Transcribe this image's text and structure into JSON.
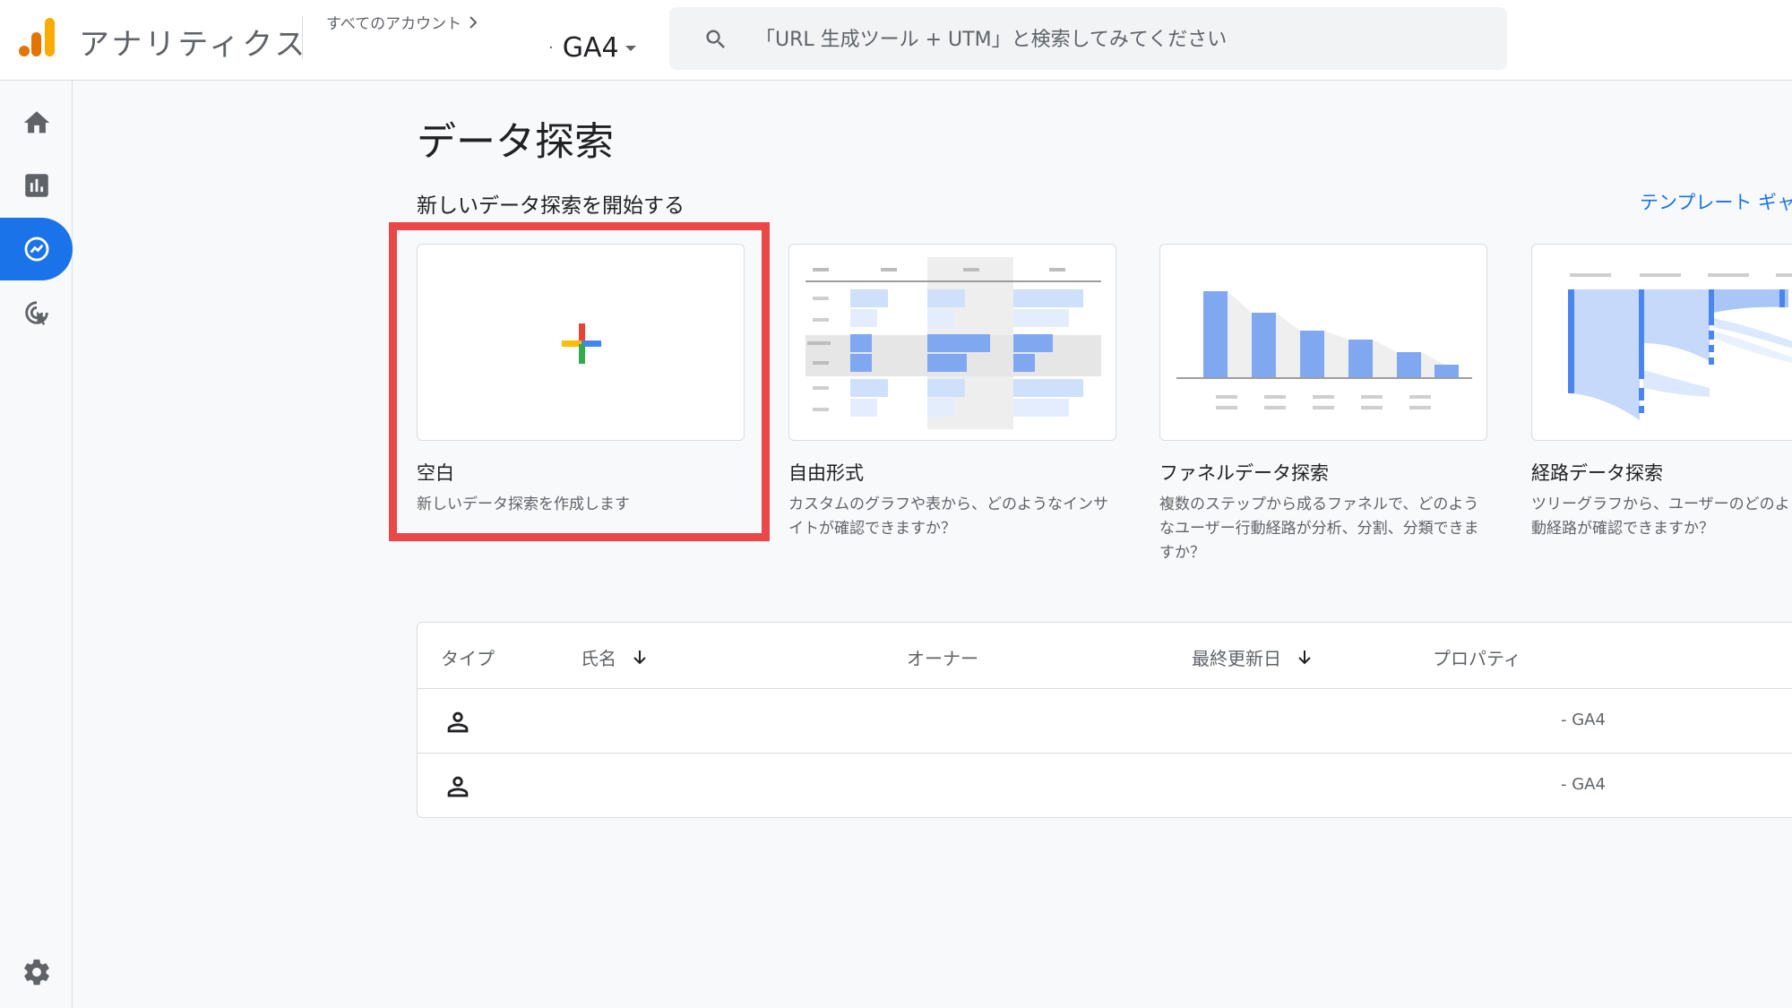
{
  "header": {
    "app_title": "アナリティクス",
    "all_accounts": "すべてのアカウント",
    "property": "GA4",
    "property_prefix": "·",
    "search_placeholder": "「URL 生成ツール + UTM」と検索してみてください"
  },
  "sidebar": {
    "items": [
      {
        "name": "home-icon",
        "active": false
      },
      {
        "name": "reports-icon",
        "active": false
      },
      {
        "name": "explore-icon",
        "active": true
      },
      {
        "name": "advertising-icon",
        "active": false
      }
    ],
    "bottom": {
      "name": "settings-icon"
    }
  },
  "main": {
    "title": "データ探索",
    "section_label": "新しいデータ探索を開始する",
    "template_link": "テンプレート ギャ",
    "cards": [
      {
        "title": "空白",
        "desc": "新しいデータ探索を作成します"
      },
      {
        "title": "自由形式",
        "desc": "カスタムのグラフや表から、どのようなインサイトが確認できますか？"
      },
      {
        "title": "ファネルデータ探索",
        "desc": "複数のステップから成るファネルで、どのようなユーザー行動経路が分析、分割、分類できますか？"
      },
      {
        "title": "経路データ探索",
        "desc": "ツリーグラフから、ユーザーのどのよ 動経路が確認できますか？"
      }
    ]
  },
  "table": {
    "headers": {
      "type": "タイプ",
      "name": "氏名",
      "owner": "オーナー",
      "updated": "最終更新日",
      "property": "プロパティ"
    },
    "rows": [
      {
        "property": "- GA4"
      },
      {
        "property": "- GA4"
      }
    ]
  },
  "colors": {
    "accent": "#1a73e8",
    "highlight": "#ea4848",
    "logo_orange": "#f9ab00",
    "logo_dark_orange": "#e37400"
  }
}
